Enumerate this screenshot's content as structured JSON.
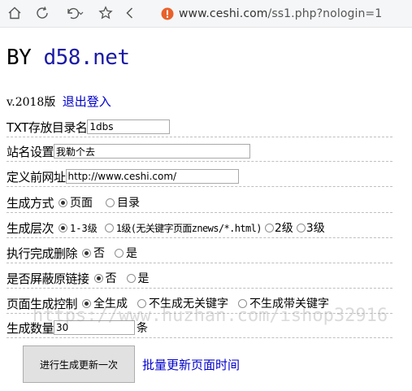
{
  "browser": {
    "url_host": "www.ceshi.com",
    "url_path": "/ss1.php?nologin=1"
  },
  "header": {
    "by": "BY",
    "site": "d58.net"
  },
  "version": {
    "label": "v.2018版",
    "logout": "退出登入"
  },
  "form": {
    "txt_dir_label": "TXT存放目录名",
    "txt_dir_value": "1dbs",
    "site_name_label": "站名设置",
    "site_name_value": "我勒个去",
    "url_label": "定义前网址",
    "url_value": "http://www.ceshi.com/",
    "gen_mode_label": "生成方式",
    "gen_mode_options": [
      "页面",
      "目录"
    ],
    "gen_level_label": "生成层次",
    "gen_level_options": [
      "1-3级",
      "1级(无关键字页面znews/*.html)",
      "2级",
      "3级"
    ],
    "delete_label": "执行完成删除",
    "delete_options": [
      "否",
      "是"
    ],
    "shield_label": "是否屏蔽原链接",
    "shield_options": [
      "否",
      "是"
    ],
    "page_ctrl_label": "页面生成控制",
    "page_ctrl_options": [
      "全生成",
      "不生成无关键字",
      "不生成带关键字"
    ],
    "count_label": "生成数量",
    "count_value": "30",
    "count_unit": "条"
  },
  "watermark": "https://www.huzhan.com/ishop32916",
  "actions": {
    "run_button": "进行生成更新一次",
    "batch_link": "批量更新页面时间"
  }
}
